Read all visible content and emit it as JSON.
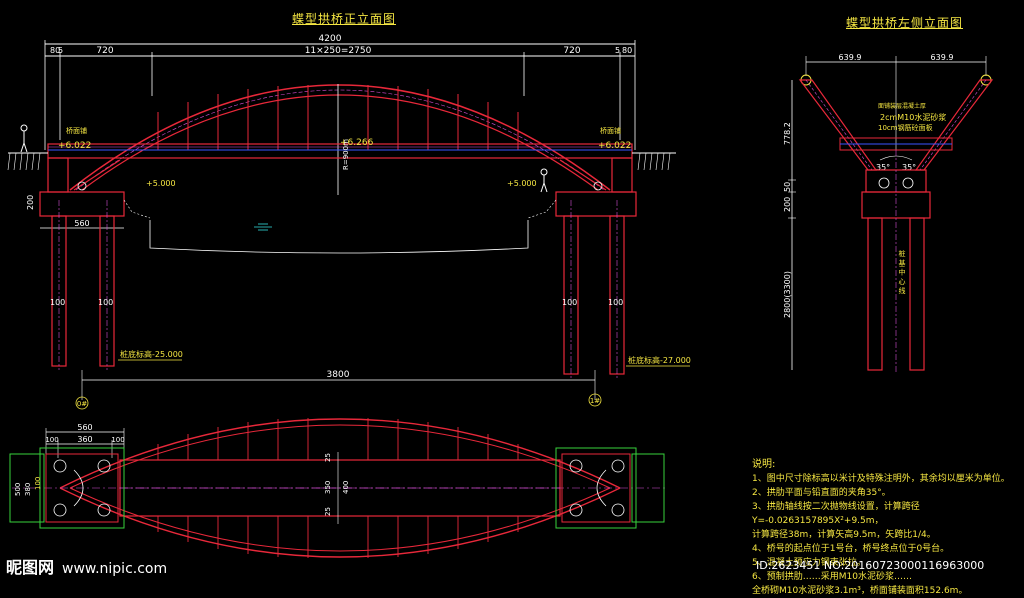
{
  "titles": {
    "front": "蝶型拱桥正立面图",
    "side": "蝶型拱桥左侧立面图"
  },
  "front_dims": {
    "total": "4200",
    "left_edge": "80",
    "left_edge2": "5",
    "left_span": "720",
    "middle": "11×250=2750",
    "right_span": "720",
    "right_edge": "5",
    "right_edge2": "80",
    "deck_elev": "+6.266",
    "left_elev": "+6.022",
    "right_elev": "+6.022",
    "left_cap": "+5.000",
    "right_cap": "+5.000",
    "radius": "R=900m",
    "left_label": "桥面铺",
    "right_label": "桥面铺",
    "cap_h": "200",
    "cap_w": "560",
    "pile_left1": "100",
    "pile_left2": "100",
    "pile_right1": "100",
    "pile_right2": "100",
    "left_bottom": "桩底标高-25.000",
    "right_bottom": "桩底标高-27.000",
    "span_3800": "3800",
    "axis_left": "0#",
    "axis_right": "1#"
  },
  "side_dims": {
    "left_w": "639.9",
    "right_w": "639.9",
    "v1": "778.2",
    "v2": "200",
    "v3": "50",
    "v4": "2800(3300)",
    "angle_l": "35°",
    "angle_r": "35°",
    "note1": "面铺装层混凝土厚",
    "note2": "2cmM10水泥砂浆",
    "note3": "10cm钢筋砼面板",
    "pile_note": "桩 基 中 心 线"
  },
  "plan_dims": {
    "w560": "560",
    "w100a": "100",
    "w360": "360",
    "w100b": "100",
    "h500": "500",
    "h380": "380",
    "h100a": "100",
    "c25a": "25",
    "c350": "350",
    "c25b": "25",
    "c400": "400"
  },
  "notes": {
    "heading": "说明:",
    "lines": [
      "1、图中尺寸除标高以米计及特殊注明外，其余均以厘米为单位。",
      "2、拱肋平面与铅直面的夹角35°。",
      "3、拱肋轴线按二次抛物线设置，计算跨径Y=-0.0263157895X²+9.5m，",
      "   计算跨径38m，计算矢高9.5m，矢跨比1/4。",
      "4、桥号的起点位于1号台，桥号终点位于0号台。",
      "5、混凝土预应力钢束张拉。",
      "6、预制拱肋……采用M10水泥砂浆……",
      "   全桥砌M10水泥砂浆3.1m³，桥面铺装面积152.6m。"
    ]
  },
  "watermark": {
    "brand": "昵图网",
    "site": "www.nipic.com"
  },
  "image_id": "ID:2623451 NO:20160723000116963000",
  "colors": {
    "arch": "#e8283a",
    "dim": "#ffffff",
    "text": "#f5e642",
    "struct": "#e8283a",
    "blue": "#3a54ff",
    "green": "#37d23c",
    "magenta": "#d64fd6",
    "cyan": "#33e0e0"
  }
}
